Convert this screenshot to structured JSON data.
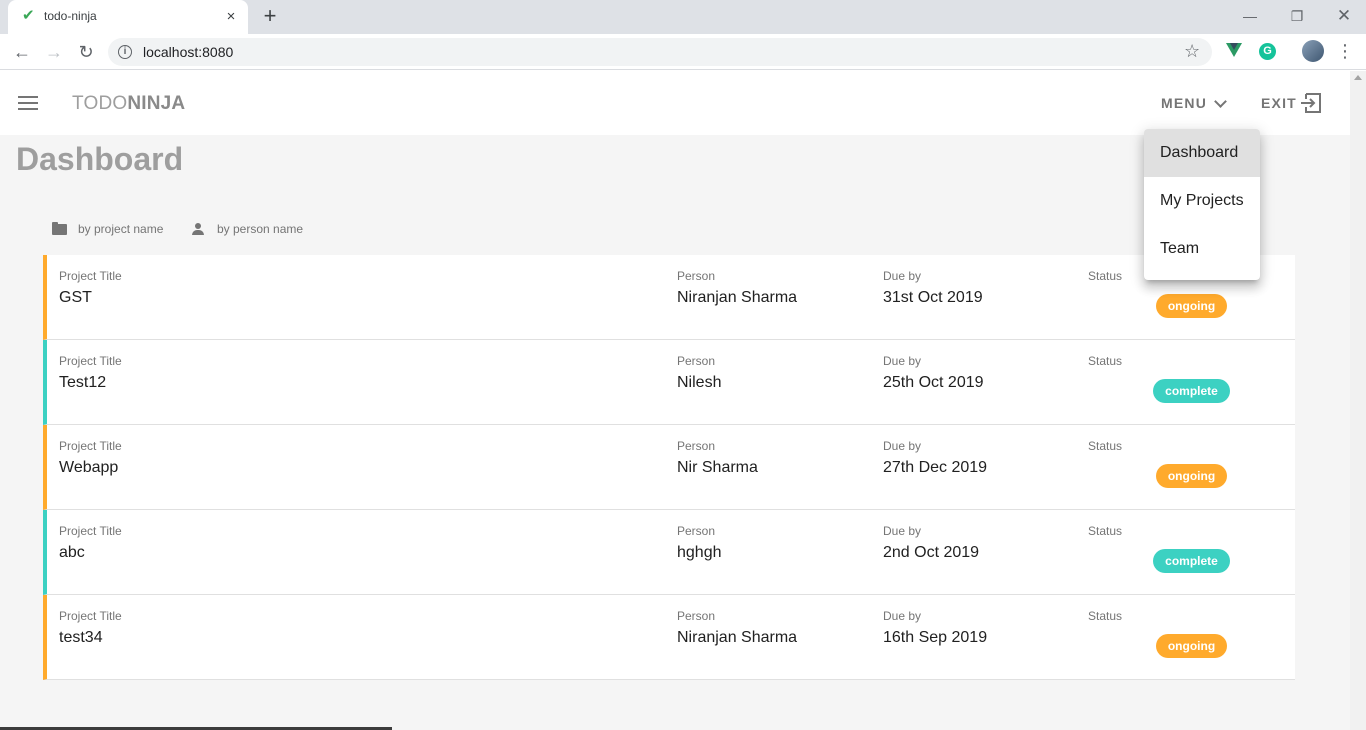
{
  "browser": {
    "tab_title": "todo-ninja",
    "url": "localhost:8080",
    "favicon": "check-icon",
    "tab_close": "×",
    "new_tab": "+"
  },
  "app": {
    "brand_thin": "TODO",
    "brand_bold": "NINJA",
    "menu_label": "MENU",
    "exit_label": "EXIT",
    "page_title": "Dashboard",
    "sort_project": "by project name",
    "sort_person": "by person name",
    "labels": {
      "title": "Project Title",
      "person": "Person",
      "due": "Due by",
      "status": "Status"
    },
    "projects": [
      {
        "title": "GST",
        "person": "Niranjan Sharma",
        "due": "31st Oct 2019",
        "status": "ongoing"
      },
      {
        "title": "Test12",
        "person": "Nilesh",
        "due": "25th Oct 2019",
        "status": "complete"
      },
      {
        "title": "Webapp",
        "person": "Nir Sharma",
        "due": "27th Dec 2019",
        "status": "ongoing"
      },
      {
        "title": "abc",
        "person": "hghgh",
        "due": "2nd Oct 2019",
        "status": "complete"
      },
      {
        "title": "test34",
        "person": "Niranjan Sharma",
        "due": "16th Sep 2019",
        "status": "ongoing"
      }
    ],
    "dropdown": [
      {
        "label": "Dashboard",
        "active": true
      },
      {
        "label": "My Projects",
        "active": false
      },
      {
        "label": "Team",
        "active": false
      }
    ]
  },
  "colors": {
    "ongoing": "#ffaa2c",
    "complete": "#3cd1c2"
  }
}
